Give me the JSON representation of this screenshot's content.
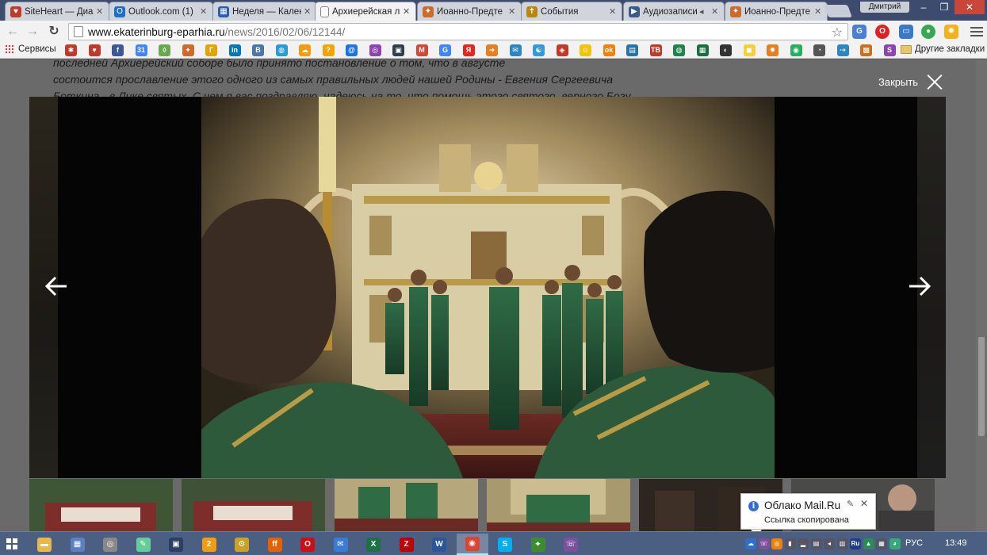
{
  "browser": {
    "tabs": [
      {
        "title": "SiteHeart — Диа",
        "color": "#c0392b",
        "glyph": "♥",
        "active": false
      },
      {
        "title": "Outlook.com (1)",
        "color": "#1f6fc5",
        "glyph": "O",
        "active": false
      },
      {
        "title": "Неделя — Кален",
        "color": "#2b5fae",
        "glyph": "▦",
        "active": false
      },
      {
        "title": "Архиерейская л",
        "color": "#ffffff",
        "glyph": "",
        "active": true
      },
      {
        "title": "Иоанно-Предте",
        "color": "#cc6b2c",
        "glyph": "✦",
        "active": false
      },
      {
        "title": "События",
        "color": "#b8860b",
        "glyph": "✝",
        "active": false
      },
      {
        "title": "Аудиозаписи",
        "color": "#3a5a8a",
        "glyph": "▶",
        "active": false
      },
      {
        "title": "Иоанно-Предте",
        "color": "#cc6b2c",
        "glyph": "✦",
        "active": false
      }
    ],
    "user_name": "Дмитрий",
    "window_controls": {
      "minimize": "–",
      "maximize": "❐",
      "close": "✕"
    },
    "url_host": "www.ekaterinburg-eparhia.ru",
    "url_path": "/news/2016/02/06/12144/",
    "nav": {
      "back": "←",
      "forward": "→",
      "reload": "↻",
      "star": "☆"
    },
    "extensions": [
      {
        "name": "translate-icon",
        "glyph": "G",
        "color": "#4a7fd6"
      },
      {
        "name": "opera-ext-icon",
        "glyph": "O",
        "color": "#d22"
      },
      {
        "name": "chat-icon",
        "glyph": "▭",
        "color": "#3a78c8"
      },
      {
        "name": "sync-icon",
        "glyph": "●",
        "color": "#35a852"
      },
      {
        "name": "sun-icon",
        "glyph": "✺",
        "color": "#f2b21c"
      }
    ]
  },
  "bookmarks": {
    "apps_label": "Сервисы",
    "icons": [
      {
        "glyph": "✱",
        "color": "#c0392b"
      },
      {
        "glyph": "♥",
        "color": "#c0392b"
      },
      {
        "glyph": "f",
        "color": "#3b5998"
      },
      {
        "glyph": "31",
        "color": "#4285f4"
      },
      {
        "glyph": "◊",
        "color": "#6aa84f"
      },
      {
        "glyph": "✦",
        "color": "#cc6b2c"
      },
      {
        "glyph": "Г",
        "color": "#e0a500"
      },
      {
        "glyph": "in",
        "color": "#0077b5"
      },
      {
        "glyph": "B",
        "color": "#4a76a8"
      },
      {
        "glyph": "◍",
        "color": "#2b9bd6"
      },
      {
        "glyph": "☁",
        "color": "#f39c12"
      },
      {
        "glyph": "?",
        "color": "#f0a500"
      },
      {
        "glyph": "@",
        "color": "#1a73e8"
      },
      {
        "glyph": "◎",
        "color": "#8e44ad"
      },
      {
        "glyph": "▣",
        "color": "#2c3e50"
      },
      {
        "glyph": "M",
        "color": "#d44638"
      },
      {
        "glyph": "G",
        "color": "#4285f4"
      },
      {
        "glyph": "Я",
        "color": "#e52620"
      },
      {
        "glyph": "➜",
        "color": "#e67e22"
      },
      {
        "glyph": "✉",
        "color": "#2e86c1"
      },
      {
        "glyph": "☯",
        "color": "#3498db"
      },
      {
        "glyph": "◈",
        "color": "#c0392b"
      },
      {
        "glyph": "☺",
        "color": "#f1c40f"
      },
      {
        "glyph": "ok",
        "color": "#ee8208"
      },
      {
        "glyph": "▤",
        "color": "#2874a6"
      },
      {
        "glyph": "ТВ",
        "color": "#c0392b"
      },
      {
        "glyph": "◍",
        "color": "#1e8449"
      },
      {
        "glyph": "▦",
        "color": "#196f3d"
      },
      {
        "glyph": "◐",
        "color": "#333"
      },
      {
        "glyph": "◼",
        "color": "#f4d03f"
      },
      {
        "glyph": "✹",
        "color": "#e67e22"
      },
      {
        "glyph": "◉",
        "color": "#27ae60"
      },
      {
        "glyph": "◔",
        "color": "#555"
      },
      {
        "glyph": "⇢",
        "color": "#2e86c1"
      },
      {
        "glyph": "▩",
        "color": "#ca6f1e"
      },
      {
        "glyph": "S",
        "color": "#8e44ad"
      }
    ],
    "other_label": "Другие закладки"
  },
  "article": {
    "lines": [
      "последней Архиерейский соборе было принято постановление о том, что в августе",
      "состоится прославление этого одного из самых правильных людей нашей Родины - Евгения Сергеевича",
      "Боткина - в Лике святых. С чем я вас поздравляю, надеюсь на то, что помощь этого святого, верного Богу,"
    ]
  },
  "lightbox": {
    "close_label": "Закрыть",
    "prev": "previous-photo",
    "next": "next-photo",
    "thumbnail_count": 6
  },
  "notification": {
    "title": "Облако Mail.Ru",
    "body": "Ссылка скопирована",
    "info_glyph": "i",
    "pin_glyph": "✎",
    "close_glyph": "✕"
  },
  "taskbar": {
    "apps": [
      {
        "name": "file-explorer",
        "glyph": "▬",
        "color": "#e8b84a"
      },
      {
        "name": "calculator",
        "glyph": "▦",
        "color": "#5b7fbf"
      },
      {
        "name": "disk-tool",
        "glyph": "◎",
        "color": "#888"
      },
      {
        "name": "notepad",
        "glyph": "✎",
        "color": "#6c9"
      },
      {
        "name": "save-tool",
        "glyph": "▣",
        "color": "#2d3e66"
      },
      {
        "name": "aimp",
        "glyph": "2",
        "color": "#f39c12"
      },
      {
        "name": "utility",
        "glyph": "⚙",
        "color": "#c9a227"
      },
      {
        "name": "firefox",
        "glyph": "ff",
        "color": "#e66000"
      },
      {
        "name": "opera",
        "glyph": "O",
        "color": "#cc0f16"
      },
      {
        "name": "mail",
        "glyph": "✉",
        "color": "#3a7bd5"
      },
      {
        "name": "excel",
        "glyph": "X",
        "color": "#1e7145"
      },
      {
        "name": "filezilla",
        "glyph": "Z",
        "color": "#bf0000"
      },
      {
        "name": "word",
        "glyph": "W",
        "color": "#2b579a"
      },
      {
        "name": "chrome",
        "glyph": "◉",
        "color": "#db4437",
        "active": true
      },
      {
        "name": "skype",
        "glyph": "S",
        "color": "#00aff0"
      },
      {
        "name": "cad-tool",
        "glyph": "⌖",
        "color": "#3c8d2f"
      },
      {
        "name": "viber",
        "glyph": "☏",
        "color": "#7b519d"
      }
    ],
    "tray": [
      {
        "glyph": "☁",
        "color": "#2f6fce"
      },
      {
        "glyph": "☏",
        "color": "#7b519d"
      },
      {
        "glyph": "◎",
        "color": "#ee8208"
      },
      {
        "glyph": "▮",
        "color": "#556"
      },
      {
        "glyph": "▂",
        "color": "#556"
      },
      {
        "glyph": "▤",
        "color": "#556"
      },
      {
        "glyph": "◂",
        "color": "#556"
      },
      {
        "glyph": "▥",
        "color": "#556"
      },
      {
        "glyph": "Ru",
        "color": "#1f3b8a"
      },
      {
        "glyph": "▲",
        "color": "#2e8b57"
      },
      {
        "glyph": "▦",
        "color": "#556"
      },
      {
        "glyph": "◕",
        "color": "#3a7"
      }
    ],
    "language": "РУС",
    "time": "13:49"
  }
}
